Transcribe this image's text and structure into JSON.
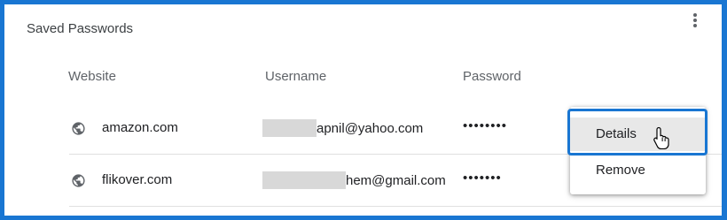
{
  "section": {
    "title": "Saved Passwords"
  },
  "icons": {
    "menu": "more-vert-icon",
    "site": "globe-icon",
    "pointer": "hand-pointer-cursor"
  },
  "columns": {
    "website": "Website",
    "username": "Username",
    "password": "Password"
  },
  "rows": [
    {
      "website": "amazon.com",
      "username_visible": "apnil@yahoo.com",
      "password": "••••••••"
    },
    {
      "website": "flikover.com",
      "username_visible": "hem@gmail.com",
      "password": "•••••••"
    }
  ],
  "context_menu": {
    "items": [
      "Details",
      "Remove"
    ],
    "highlighted": "Details"
  },
  "colors": {
    "accent": "#1976d2",
    "menu_hover": "#e8e8e8"
  }
}
